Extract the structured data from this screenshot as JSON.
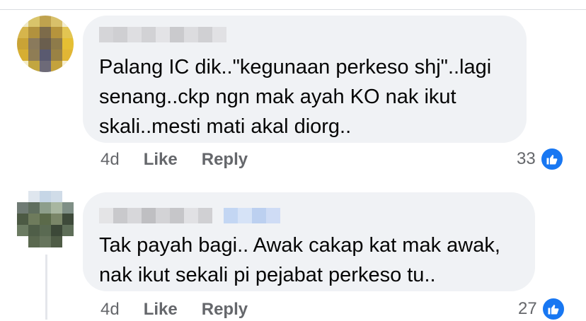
{
  "comments": [
    {
      "text": "Palang IC dik..\"kegunaan perkeso shj\"..lagi\nsenang..ckp ngn mak ayah KO nak ikut\nskali..mesti mati akal diorg..",
      "time": "4d",
      "like_label": "Like",
      "reply_label": "Reply",
      "reaction_count": "33",
      "reaction_icon": "thumbs-up-icon",
      "reaction_color": "#1877f2"
    },
    {
      "text": "Tak payah bagi.. Awak cakap kat mak awak,\nnak ikut sekali pi pejabat perkeso tu..",
      "time": "4d",
      "like_label": "Like",
      "reply_label": "Reply",
      "reaction_count": "27",
      "reaction_icon": "thumbs-up-icon",
      "reaction_color": "#1877f2"
    }
  ],
  "colors": {
    "bubble_bg": "#f0f2f5",
    "meta_text": "#65676b",
    "body_text": "#050505",
    "accent": "#1877f2"
  }
}
